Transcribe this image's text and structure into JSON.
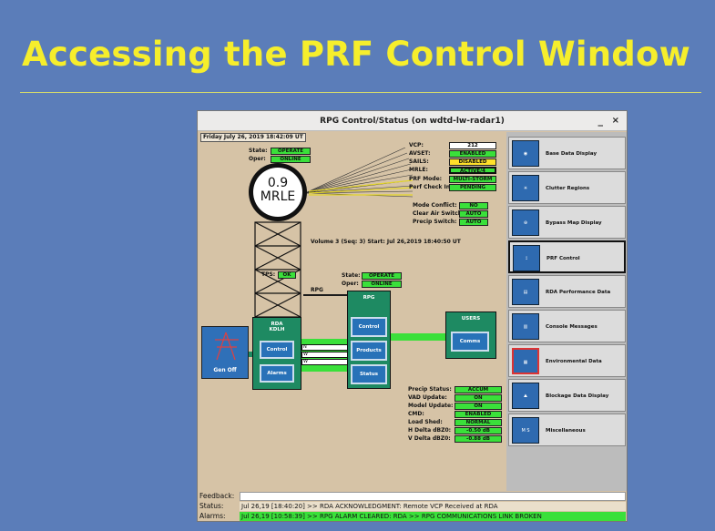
{
  "slide": {
    "title": "Accessing the PRF Control Window"
  },
  "window": {
    "title": "RPG Control/Status (on wdtd-lw-radar1)",
    "min": "_",
    "close": "×"
  },
  "datetime": "Friday July 26, 2019   18:42:09 UT",
  "radome": {
    "state_label": "State:",
    "state_value": "OPERATE",
    "oper_label": "Oper:",
    "oper_value": "ONLINE",
    "site_line1": "0.9",
    "site_line2": "MRLE"
  },
  "status": [
    {
      "label": "VCP:",
      "value": "212"
    },
    {
      "label": "AVSET:",
      "value": "ENABLED"
    },
    {
      "label": "SAILS:",
      "value": "DISABLED"
    },
    {
      "label": "MRLE:",
      "value": "ACTIVE/4"
    },
    {
      "label": "PRF Mode:",
      "value": "MULTI-STORM"
    },
    {
      "label": "Perf Check In:",
      "value": "PENDING"
    }
  ],
  "modes": [
    {
      "label": "Mode Conflict:",
      "value": "NO"
    },
    {
      "label": "Clear Air Switch:",
      "value": "AUTO"
    },
    {
      "label": "Precip Switch:",
      "value": "AUTO"
    }
  ],
  "volume": "Volume 3 (Seq: 3) Start: Jul 26,2019    18:40:50 UT",
  "tps": {
    "label": "TPS:",
    "value": "OK"
  },
  "rpg_state": {
    "state_label": "State:",
    "state_value": "OPERATE",
    "oper_label": "Oper:",
    "oper_value": "ONLINE"
  },
  "rpg_line_label": "RPG",
  "gen": {
    "label": "Gen Off"
  },
  "rda": {
    "title_line1": "RDA",
    "title_line2": "KDLH",
    "control": "Control",
    "alarms": "Alarms"
  },
  "links": [
    "N",
    "W",
    "W"
  ],
  "rpg": {
    "title": "RPG",
    "control": "Control",
    "products": "Products",
    "status": "Status"
  },
  "users": {
    "title": "USERS",
    "comms": "Comms"
  },
  "bottom": [
    {
      "label": "Precip Status:",
      "value": "ACCUM"
    },
    {
      "label": "VAD Update:",
      "value": "ON"
    },
    {
      "label": "Model Update:",
      "value": "ON"
    },
    {
      "label": "CMD:",
      "value": "ENABLED"
    },
    {
      "label": "Load Shed:",
      "value": "NORMAL"
    },
    {
      "label": "H Delta dBZ0:",
      "value": "-0.50 dB"
    },
    {
      "label": "V Delta dBZ0:",
      "value": "-0.88 dB"
    }
  ],
  "panel": [
    {
      "label": "Base Data Display",
      "icon": "base-data-icon"
    },
    {
      "label": "Clutter Regions",
      "icon": "clutter-icon"
    },
    {
      "label": "Bypass Map Display",
      "icon": "bypass-map-icon"
    },
    {
      "label": "PRF Control",
      "icon": "prf-icon"
    },
    {
      "label": "RDA Performance Data",
      "icon": "rda-performance-icon"
    },
    {
      "label": "Console Messages",
      "icon": "console-icon"
    },
    {
      "label": "Environmental Data",
      "icon": "environmental-icon"
    },
    {
      "label": "Blockage Data Display",
      "icon": "blockage-icon"
    },
    {
      "label": "Miscellaneous",
      "icon": "misc-icon"
    }
  ],
  "footer": {
    "feedback_label": "Feedback:",
    "feedback_value": "",
    "status_label": "Status:",
    "status_value": "Jul 26,19 [18:40:20] >> RDA ACKNOWLEDGMENT: Remote VCP Received at RDA",
    "alarms_label": "Alarms:",
    "alarms_value": "Jul 26,19 [10:58:39] >> RPG ALARM CLEARED: RDA >> RPG COMMUNICATIONS LINK BROKEN"
  },
  "colors": {
    "slide_bg": "#5b7db9",
    "title": "#f6ee2c",
    "window_bg": "#d6c3a6",
    "green": "#3ae03a",
    "teal": "#1e8a62"
  }
}
